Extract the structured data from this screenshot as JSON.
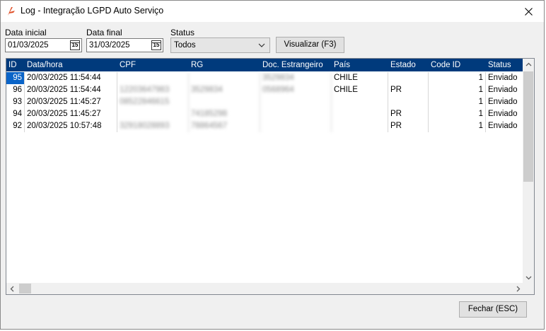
{
  "window": {
    "title": "Log - Integração LGPD Auto Serviço"
  },
  "filters": {
    "data_inicial_label": "Data inicial",
    "data_inicial_value": "01/03/2025",
    "data_final_label": "Data final",
    "data_final_value": "31/03/2025",
    "calendar_glyph": "15",
    "status_label": "Status",
    "status_value": "Todos",
    "visualizar_label": "Visualizar (F3)"
  },
  "grid": {
    "columns": [
      "ID",
      "Data/hora",
      "CPF",
      "RG",
      "Doc. Estrangeiro",
      "País",
      "Estado",
      "Code ID",
      "Status"
    ],
    "rows": [
      {
        "id": "95",
        "datahora": "20/03/2025 11:54:44",
        "cpf": "",
        "rg": "",
        "doc": "3529834",
        "pais": "CHILE",
        "estado": "",
        "code": "1",
        "status": "Enviado"
      },
      {
        "id": "96",
        "datahora": "20/03/2025 11:54:44",
        "cpf": "12203647983",
        "rg": "3529834",
        "doc": "0568964",
        "pais": "CHILE",
        "estado": "PR",
        "code": "1",
        "status": "Enviado"
      },
      {
        "id": "93",
        "datahora": "20/03/2025 11:45:27",
        "cpf": "08522846615",
        "rg": "",
        "doc": "",
        "pais": "",
        "estado": "",
        "code": "1",
        "status": "Enviado"
      },
      {
        "id": "94",
        "datahora": "20/03/2025 11:45:27",
        "cpf": "",
        "rg": "74185298",
        "doc": "",
        "pais": "",
        "estado": "PR",
        "code": "1",
        "status": "Enviado"
      },
      {
        "id": "92",
        "datahora": "20/03/2025 10:57:48",
        "cpf": "32918028893",
        "rg": "78864567",
        "doc": "",
        "pais": "",
        "estado": "PR",
        "code": "1",
        "status": "Enviado"
      }
    ],
    "selected_row": 0
  },
  "footer": {
    "fechar_label": "Fechar (ESC)"
  },
  "colors": {
    "header_bg": "#003a7c",
    "selection": "#0a64c8",
    "accent_icon": "#e0522b"
  }
}
